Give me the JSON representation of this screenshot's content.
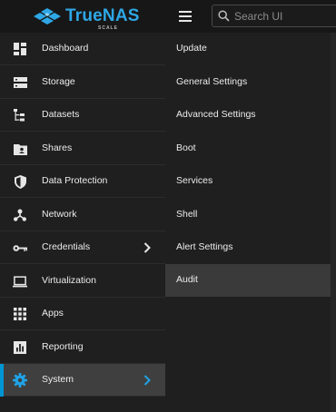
{
  "header": {
    "logo_name": "TrueNAS",
    "logo_sub": "SCALE",
    "menu_icon": "hamburger-icon",
    "search_icon": "search-icon",
    "search_placeholder": "Search UI"
  },
  "colors": {
    "accent": "#0095d5",
    "logo": "#2ea7e6",
    "background": "#1f1f1f",
    "active_item": "#3f3f3f",
    "hover_item": "#3a3a3a"
  },
  "sidebar": {
    "items": [
      {
        "label": "Dashboard",
        "icon": "dashboard-icon"
      },
      {
        "label": "Storage",
        "icon": "storage-icon"
      },
      {
        "label": "Datasets",
        "icon": "datasets-icon"
      },
      {
        "label": "Shares",
        "icon": "shares-icon"
      },
      {
        "label": "Data Protection",
        "icon": "shield-icon"
      },
      {
        "label": "Network",
        "icon": "network-icon"
      },
      {
        "label": "Credentials",
        "icon": "key-icon",
        "has_submenu": true
      },
      {
        "label": "Virtualization",
        "icon": "laptop-icon"
      },
      {
        "label": "Apps",
        "icon": "apps-grid-icon"
      },
      {
        "label": "Reporting",
        "icon": "reporting-icon"
      },
      {
        "label": "System",
        "icon": "gear-icon",
        "has_submenu": true,
        "active": true
      }
    ]
  },
  "submenu": {
    "items": [
      {
        "label": "Update"
      },
      {
        "label": "General Settings"
      },
      {
        "label": "Advanced Settings"
      },
      {
        "label": "Boot"
      },
      {
        "label": "Services"
      },
      {
        "label": "Shell"
      },
      {
        "label": "Alert Settings"
      },
      {
        "label": "Audit",
        "hovered": true
      }
    ]
  }
}
